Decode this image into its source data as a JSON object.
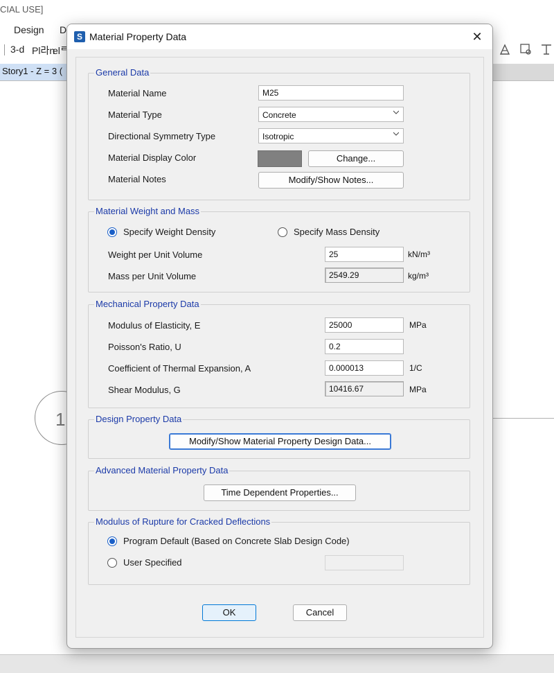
{
  "background": {
    "title_fragment": "CIAL USE]",
    "menu": [
      "Design",
      "D"
    ],
    "toolbar": [
      "3-d",
      "Pl라n",
      "elᄅ"
    ],
    "view_tab": "Story1 - Z = 3 (",
    "grid_bubble": "1"
  },
  "dialog": {
    "title": "Material Property Data",
    "close": "✕"
  },
  "general": {
    "title": "General Data",
    "name_label": "Material Name",
    "name_value": "M25",
    "type_label": "Material Type",
    "type_value": "Concrete",
    "symmetry_label": "Directional Symmetry Type",
    "symmetry_value": "Isotropic",
    "color_label": "Material Display Color",
    "color_value": "#808080",
    "change_button": "Change...",
    "notes_label": "Material Notes",
    "notes_button": "Modify/Show Notes..."
  },
  "weight_mass": {
    "title": "Material Weight and Mass",
    "option_weight": "Specify Weight Density",
    "option_mass": "Specify Mass Density",
    "selected": "weight",
    "weight_label": "Weight per Unit Volume",
    "weight_value": "25",
    "weight_unit": "kN/m³",
    "mass_label": "Mass per Unit Volume",
    "mass_value": "2549.29",
    "mass_unit": "kg/m³"
  },
  "mechanical": {
    "title": "Mechanical Property Data",
    "e_label": "Modulus of Elasticity,  E",
    "e_value": "25000",
    "e_unit": "MPa",
    "u_label": "Poisson's Ratio,  U",
    "u_value": "0.2",
    "a_label": "Coefficient of Thermal Expansion,  A",
    "a_value": "0.000013",
    "a_unit": "1/C",
    "g_label": "Shear Modulus,  G",
    "g_value": "10416.67",
    "g_unit": "MPa"
  },
  "design": {
    "title": "Design Property Data",
    "button": "Modify/Show Material Property Design Data..."
  },
  "advanced": {
    "title": "Advanced Material Property Data",
    "button": "Time Dependent Properties..."
  },
  "rupture": {
    "title": "Modulus of Rupture for Cracked Deflections",
    "option_default": "Program Default  (Based on Concrete Slab Design Code)",
    "option_user": "User Specified",
    "selected": "default",
    "user_value": ""
  },
  "footer": {
    "ok": "OK",
    "cancel": "Cancel"
  },
  "colors": {
    "group_title": "#1b3aa8",
    "accent": "#1a5fc7"
  }
}
